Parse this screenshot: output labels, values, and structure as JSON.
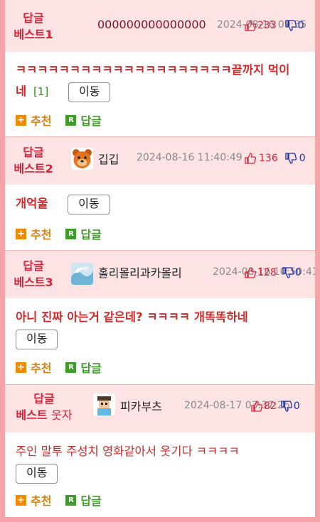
{
  "comments": [
    {
      "badge_line1": "답글",
      "badge_line2": "베스트1",
      "username": "000000000000000",
      "date": "2024-08-16 09:35",
      "upvotes": "233",
      "downvotes": "0",
      "content": "ㅋㅋㅋㅋㅋㅋㅋㅋㅋㅋㅋㅋㅋㅋㅋㅋㅋㅋㅋㅋ끝까지 먹이네",
      "reply_count": "[1]",
      "move_label": "이동",
      "recommend_label": "추천",
      "reply_label": "답글",
      "recommend_icon": "+",
      "reply_icon": "R"
    },
    {
      "badge_line1": "답글",
      "badge_line2": "베스트2",
      "username": "깁깁",
      "date": "2024-08-16 11:40:49",
      "upvotes": "136",
      "downvotes": "0",
      "content": "개억울",
      "move_label": "이동",
      "recommend_label": "추천",
      "reply_label": "답글",
      "recommend_icon": "+",
      "reply_icon": "R",
      "avatar": "bear-avatar"
    },
    {
      "badge_line1": "답글",
      "badge_line2": "베스트3",
      "username": "홀리몰리과카몰리",
      "date": "2024-08-16 10:50:41",
      "upvotes": "128",
      "downvotes": "0",
      "content": "아니 진짜 아는거 같은데? ㅋㅋㅋㅋ 개똑똑하네",
      "move_label": "이동",
      "recommend_label": "추천",
      "reply_label": "답글",
      "recommend_icon": "+",
      "reply_icon": "R",
      "avatar": "wave-avatar"
    },
    {
      "badge_line1": "답글",
      "badge_line2a": "베스트",
      "badge_line2b": "웃자",
      "username": "피카부츠",
      "date": "2024-08-17 03:37:26",
      "upvotes": "82",
      "downvotes": "0",
      "content": "주인 말투 주성치 영화같아서 웃기다 ㅋㅋㅋㅋ",
      "move_label": "이동",
      "recommend_label": "추천",
      "reply_label": "답글",
      "recommend_icon": "+",
      "reply_icon": "R",
      "avatar": "pixel-avatar"
    }
  ],
  "colors": {
    "frame": "#f5a3a8",
    "header_bg": "#fde3e4",
    "badge": "#d6243b",
    "recommend": "#d9820b",
    "reply": "#3f9c2a",
    "upvote": "#e0213a",
    "downvote": "#1f2fa8"
  },
  "icons": {
    "thumbs_up": "thumbs-up-icon",
    "thumbs_down": "thumbs-down-icon",
    "recommend": "plus-icon",
    "reply": "r-icon"
  }
}
